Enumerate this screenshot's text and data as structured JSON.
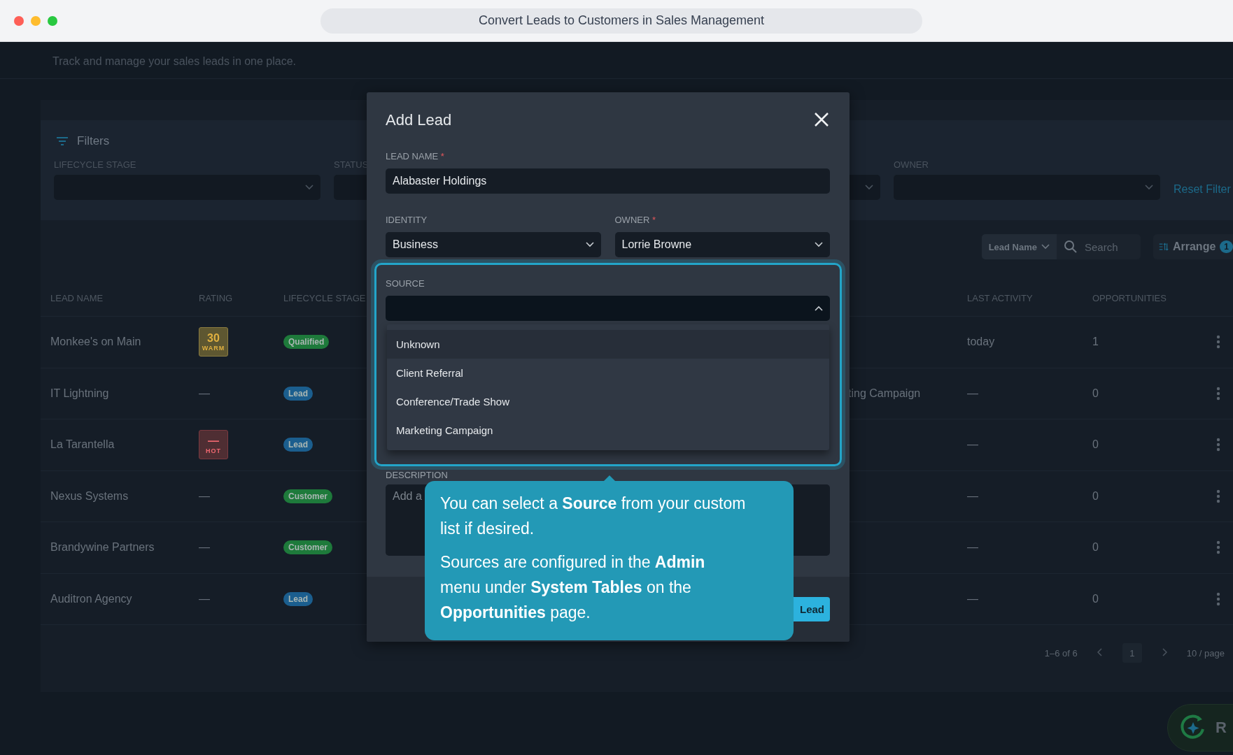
{
  "window": {
    "title": "Convert Leads to Customers in Sales Management"
  },
  "header": {
    "subtitle": "Track and manage your sales leads in one place."
  },
  "filters": {
    "title": "Filters",
    "fields": [
      {
        "label": "LIFECYCLE STAGE"
      },
      {
        "label": "STATUS"
      },
      {
        "label": "OWNER"
      }
    ],
    "reset": "Reset Filter"
  },
  "toolbar": {
    "search_by": "Lead Name",
    "search": {
      "placeholder": "Search"
    },
    "arrange": "Arrange",
    "arrange_badge": "1"
  },
  "table": {
    "columns": [
      "LEAD NAME",
      "RATING",
      "LIFECYCLE STAGE",
      "LAST ACTIVITY",
      "OPPORTUNITIES"
    ],
    "rows": [
      {
        "name": "Monkee's on Main",
        "rating": {
          "kind": "warm",
          "value": "30",
          "label": "WARM"
        },
        "stage": {
          "label": "Qualified",
          "color": "#1e7a3b"
        },
        "last_activity": "today",
        "opportunities": "1"
      },
      {
        "name": "IT Lightning",
        "rating": {
          "kind": "none",
          "value": "—"
        },
        "stage": {
          "label": "Lead",
          "color": "#1b5e8e"
        },
        "source": "ting Campaign",
        "last_activity": "—",
        "opportunities": "0"
      },
      {
        "name": "La Tarantella",
        "rating": {
          "kind": "hot",
          "value": "—",
          "label": "HOT"
        },
        "stage": {
          "label": "Lead",
          "color": "#1b5e8e"
        },
        "last_activity": "—",
        "opportunities": "0"
      },
      {
        "name": "Nexus Systems",
        "rating": {
          "kind": "none",
          "value": "—"
        },
        "stage": {
          "label": "Customer",
          "color": "#1e7a3b"
        },
        "last_activity": "—",
        "opportunities": "0"
      },
      {
        "name": "Brandywine Partners",
        "rating": {
          "kind": "none",
          "value": "—"
        },
        "stage": {
          "label": "Customer",
          "color": "#1e7a3b"
        },
        "last_activity": "—",
        "opportunities": "0"
      },
      {
        "name": "Auditron Agency",
        "rating": {
          "kind": "none",
          "value": "—"
        },
        "stage": {
          "label": "Lead",
          "color": "#1b5e8e"
        },
        "last_activity": "—",
        "opportunities": "0"
      }
    ]
  },
  "pagination": {
    "range": "1–6 of 6",
    "page": "1",
    "per_page": "10 / page"
  },
  "floating_button": {
    "label": "R"
  },
  "modal": {
    "title": "Add Lead",
    "lead_name": {
      "label": "LEAD NAME",
      "required_mark": "*",
      "value": "Alabaster Holdings"
    },
    "identity": {
      "label": "IDENTITY",
      "value": "Business"
    },
    "owner": {
      "label": "OWNER",
      "required_mark": "*",
      "value": "Lorrie Browne"
    },
    "source": {
      "label": "SOURCE",
      "expanded": true,
      "options": [
        {
          "label": "Unknown",
          "selected": true
        },
        {
          "label": "Client Referral",
          "selected": false
        },
        {
          "label": "Conference/Trade Show",
          "selected": false
        },
        {
          "label": "Marketing Campaign",
          "selected": false
        }
      ]
    },
    "description": {
      "label": "DESCRIPTION",
      "placeholder": "Add a"
    },
    "submit": "Lead"
  },
  "tooltip": {
    "paragraphs": [
      "You can select a **Source** from your custom list if desired.",
      "Sources are configured in the **Admin** menu under **System Tables** on the **Opportunities** page."
    ]
  }
}
